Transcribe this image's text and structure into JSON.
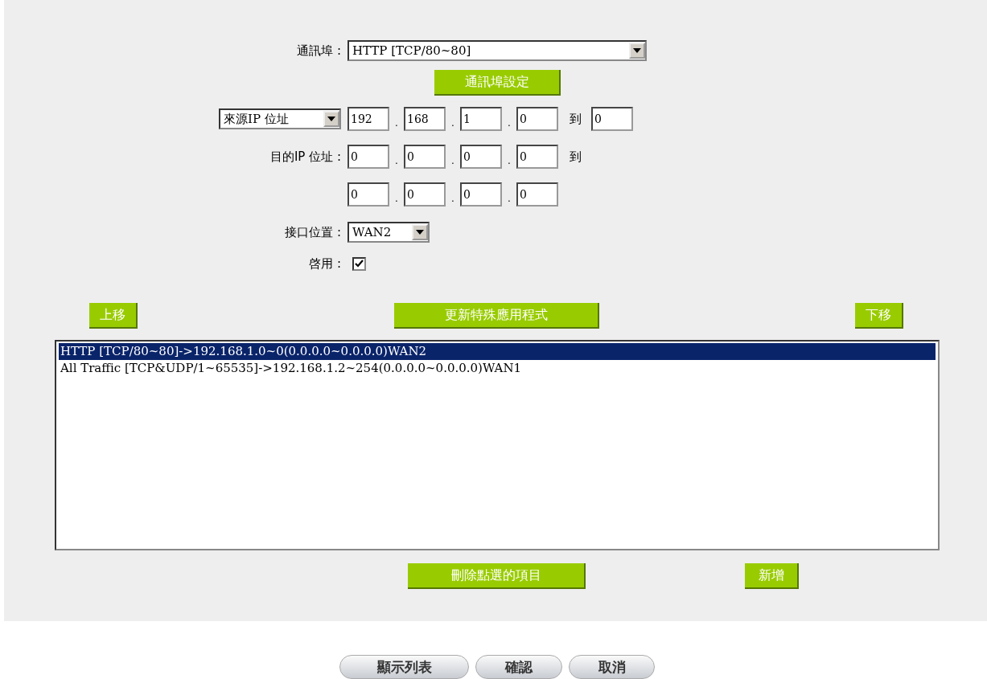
{
  "port": {
    "label": "通訊埠 :",
    "value": "HTTP [TCP/80~80]",
    "settings_button": "通訊埠設定"
  },
  "source": {
    "type_value": "來源IP 位址",
    "octets": [
      "192",
      "168",
      "1",
      "0"
    ],
    "separators": [
      ".",
      ".",
      "."
    ],
    "to_label": "到",
    "to_value": "0"
  },
  "destination": {
    "label": "目的IP 位址 :",
    "start_octets": [
      "0",
      "0",
      "0",
      "0"
    ],
    "start_separators": [
      ".",
      ".",
      "."
    ],
    "to_label": "到",
    "end_octets": [
      "0",
      "0",
      "0",
      "0"
    ],
    "end_separators": [
      ".",
      ".",
      "."
    ]
  },
  "interface": {
    "label": "接口位置 :",
    "value": "WAN2"
  },
  "enable": {
    "label": "啓用 :",
    "checked": true
  },
  "list_buttons": {
    "up": "上移",
    "update": "更新特殊應用程式",
    "down": "下移"
  },
  "rules": [
    {
      "text": "HTTP [TCP/80~80]->192.168.1.0~0(0.0.0.0~0.0.0.0)WAN2",
      "selected": true
    },
    {
      "text": "All Traffic [TCP&UDP/1~65535]->192.168.1.2~254(0.0.0.0~0.0.0.0)WAN1",
      "selected": false
    }
  ],
  "list_actions": {
    "delete": "刪除點選的項目",
    "add": "新增"
  },
  "footer_buttons": [
    "顯示列表",
    "確認",
    "取消"
  ]
}
